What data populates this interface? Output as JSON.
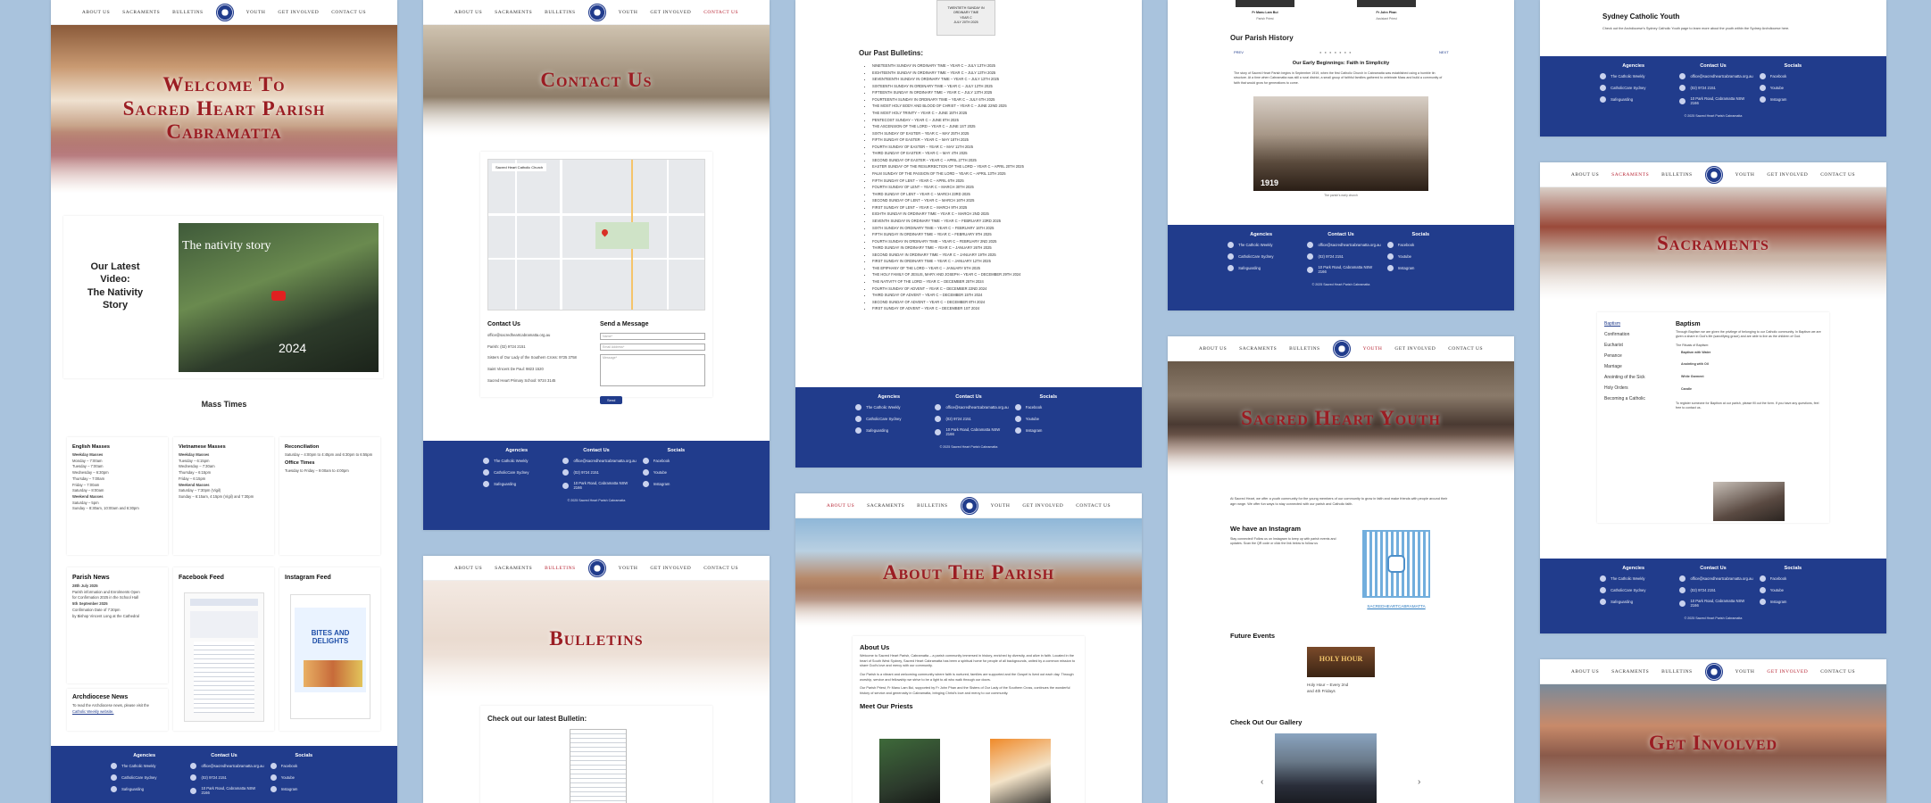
{
  "nav": {
    "left": [
      "About Us",
      "Sacraments",
      "Bulletins"
    ],
    "right": [
      "Youth",
      "Get Involved",
      "Contact Us"
    ]
  },
  "home": {
    "hero_title_lines": [
      "Welcome To",
      "Sacred Heart Parish",
      "Cabramatta"
    ],
    "video_heading_lines": [
      "Our Latest",
      "Video:",
      "The Nativity",
      "Story"
    ],
    "video_title": "The nativity story",
    "video_year": "2024",
    "mass_times_heading": "Mass Times",
    "english_heading": "English Masses",
    "english_lines": [
      "Weekday Masses",
      "Monday – 7:00am",
      "Tuesday – 7:00am",
      "Wednesday – 6:30pm",
      "Thursday – 7:00am",
      "Friday – 7:00am",
      "Saturday – 8:00am",
      "Weekend Masses",
      "Saturday – 5pm",
      "Sunday – 8:30am, 10:00am and 6:30pm"
    ],
    "vietnamese_heading": "Vietnamese Masses",
    "vietnamese_lines": [
      "Weekday Masses",
      "Tuesday – 6:15pm",
      "Wednesday – 7:30am",
      "Thursday – 6:15pm",
      "Friday – 6:15pm",
      "Weekend Masses",
      "Saturday – 7:30pm (Vigil)",
      "Sunday – 6:15am, 4:15pm (Vigil) and 7:30pm"
    ],
    "reconciliation_heading": "Reconciliation",
    "reconciliation_lines": [
      "Saturday – 4:00pm to 4:45pm and 6:30pm to 6:55pm"
    ],
    "office_heading": "Office Times",
    "office_lines": [
      "Tuesday to Friday – 9:00am to 4:00pm"
    ],
    "parish_news_heading": "Parish News",
    "parish_news_lines": [
      "28th July 2025",
      "Parish information and Enrolments Open",
      "for Confirmation 2025 in the School Hall",
      "5th September 2025",
      "Confirmation Date of 7:30pm",
      "by Bishop Vincent Long at the Cathedral"
    ],
    "facebook_heading": "Facebook Feed",
    "instagram_heading": "Instagram Feed",
    "insta_post_title": "BITES AND DELIGHTS",
    "archdiocese_heading": "Archdiocese News",
    "archdiocese_text": "To read the Archdiocese news, please visit the",
    "archdiocese_link": "Catholic Weekly website."
  },
  "footer": {
    "agencies_heading": "Agencies",
    "agencies": [
      "The Catholic Weekly",
      "CatholicCare Sydney",
      "Safeguarding"
    ],
    "contact_heading": "Contact Us",
    "contact": [
      "office@sacredheartcabramatta.org.au",
      "(02) 9724 2151",
      "10 Park Road, Cabramatta NSW 2166"
    ],
    "socials_heading": "Socials",
    "socials": [
      "Facebook",
      "Youtube",
      "Instagram"
    ],
    "copyright": "© 2025 Sacred Heart Parish Cabramatta"
  },
  "contact": {
    "hero_title": "Contact Us",
    "map_label": "Sacred Heart Catholic Church",
    "contact_heading": "Contact Us",
    "contact_lines": [
      "office@sacredheartcabramatta.org.au",
      "Parish: (02) 9724 2151",
      "Sisters of Our Lady of the Southern Cross: 9725 3758",
      "Saint Vincent De Paul: 9823 1520",
      "Sacred Heart Primary School: 9724 3145"
    ],
    "form_heading": "Send a Message",
    "form_name": "Name*",
    "form_email": "Email Address*",
    "form_message": "Message*",
    "send_label": "Send"
  },
  "bulletins": {
    "hero_title": "Bulletins",
    "latest_heading": "Check out our latest Bulletin:"
  },
  "past": {
    "thumb_caption_lines": [
      "TWENTIETH SUNDAY IN",
      "ORDINARY TIME",
      "YEAR C",
      "JULY 20TH 2025"
    ],
    "heading": "Our Past Bulletins:",
    "items": [
      "NINETEENTH SUNDAY IN ORDINARY TIME – YEAR C – JULY 13TH 2025",
      "EIGHTEENTH SUNDAY IN ORDINARY TIME – YEAR C – JULY 13TH 2025",
      "SEVENTEENTH SUNDAY IN ORDINARY TIME – YEAR C – JULY 13TH 2025",
      "SIXTEENTH SUNDAY IN ORDINARY TIME – YEAR C – JULY 13TH 2025",
      "FIFTEENTH SUNDAY IN ORDINARY TIME – YEAR C – JULY 13TH 2025",
      "FOURTEENTH SUNDAY IN ORDINARY TIME – YEAR C – JULY 6TH 2025",
      "THE MOST HOLY BODY AND BLOOD OF CHRIST – YEAR C – JUNE 22ND 2025",
      "THE MOST HOLY TRINITY – YEAR C – JUNE 15TH 2025",
      "PENTECOST SUNDAY – YEAR C – JUNE 8TH 2025",
      "THE ASCENSION OF THE LORD – YEAR C – JUNE 1ST 2025",
      "SIXTH SUNDAY OF EASTER – YEAR C – MAY 25TH 2025",
      "FIFTH SUNDAY OF EASTER – YEAR C – MAY 18TH 2025",
      "FOURTH SUNDAY OF EASTER – YEAR C – MAY 11TH 2025",
      "THIRD SUNDAY OF EASTER – YEAR C – MAY 4TH 2025",
      "SECOND SUNDAY OF EASTER – YEAR C – APRIL 27TH 2025",
      "EASTER SUNDAY OF THE RESURRECTION OF THE LORD – YEAR C – APRIL 20TH 2025",
      "PALM SUNDAY OF THE PASSION OF THE LORD – YEAR C – APRIL 13TH 2025",
      "FIFTH SUNDAY OF LENT – YEAR C – APRIL 6TH 2025",
      "FOURTH SUNDAY OF LENT – YEAR C – MARCH 30TH 2025",
      "THIRD SUNDAY OF LENT – YEAR C – MARCH 23RD 2025",
      "SECOND SUNDAY OF LENT – YEAR C – MARCH 16TH 2025",
      "FIRST SUNDAY OF LENT – YEAR C – MARCH 9TH 2025",
      "EIGHTH SUNDAY IN ORDINARY TIME – YEAR C – MARCH 2ND 2025",
      "SEVENTH SUNDAY IN ORDINARY TIME – YEAR C – FEBRUARY 23RD 2025",
      "SIXTH SUNDAY IN ORDINARY TIME – YEAR C – FEBRUARY 16TH 2025",
      "FIFTH SUNDAY IN ORDINARY TIME – YEAR C – FEBRUARY 9TH 2025",
      "FOURTH SUNDAY IN ORDINARY TIME – YEAR C – FEBRUARY 2ND 2025",
      "THIRD SUNDAY IN ORDINARY TIME – YEAR C – JANUARY 26TH 2025",
      "SECOND SUNDAY IN ORDINARY TIME – YEAR C – JANUARY 19TH 2025",
      "FIRST SUNDAY IN ORDINARY TIME – YEAR C – JANUARY 12TH 2025",
      "THE EPIPHANY OF THE LORD – YEAR C – JANUARY 5TH 2025",
      "THE HOLY FAMILY OF JESUS, MARY AND JOSEPH – YEAR C – DECEMBER 29TH 2024",
      "THE NATIVITY OF THE LORD – YEAR C – DECEMBER 25TH 2024",
      "FOURTH SUNDAY OF ADVENT – YEAR C – DECEMBER 22ND 2024",
      "THIRD SUNDAY OF ADVENT – YEAR C – DECEMBER 15TH 2024",
      "SECOND SUNDAY OF ADVENT – YEAR C – DECEMBER 8TH 2024",
      "FIRST SUNDAY OF ADVENT – YEAR C – DECEMBER 1ST 2024"
    ]
  },
  "about": {
    "hero_title": "About The Parish",
    "about_heading": "About Us",
    "about_p1": "Welcome to Sacred Heart Parish, Cabramatta – a parish community immersed in history, enriched by diversity, and alive in faith. Located in the heart of South West Sydney, Sacred Heart Cabramatta has been a spiritual home for people of all backgrounds, united by a common mission to share God's love and mercy with our community.",
    "about_p2": "Our Parish is a vibrant and welcoming community where faith is nurtured, families are supported and the Gospel is lived out each day. Through worship, service and fellowship we strive to be a light to all who walk through our doors.",
    "about_p3": "Our Parish Priest, Fr Manu Lam Bui, supported by Fr John Phan and the Sisters of Our Lady of the Southern Cross, continues the wonderful history of service and generosity in Cabramatta, bringing Christ's love and mercy to our community.",
    "priests_heading": "Meet Our Priests"
  },
  "history": {
    "priest1_name": "Fr Manu Lam Bui",
    "priest1_role": "Parish Priest",
    "priest2_name": "Fr John Phan",
    "priest2_role": "Assistant Priest",
    "heading": "Our Parish History",
    "prev_label": "PREV",
    "next_label": "NEXT",
    "subheading": "Our Early Beginnings: Faith in Simplicity",
    "text": "The story of Sacred Heart Parish begins in September 1919, when the first Catholic Church in Cabramatta was established using a humble tin structure. At a time when Cabramatta was still a rural district, a small group of faithful families gathered to celebrate Mass and build a community of faith that would grow for generations to come.",
    "photo_year": "1919",
    "photo_caption": "The parish's early church"
  },
  "youth": {
    "hero_title": "Sacred Heart Youth",
    "intro": "At Sacred Heart, we offer a youth community for the young members of our community to grow in faith and make friends with people around their age range. We offer fun ways to stay connected with our parish and Catholic faith.",
    "insta_heading": "We have an Instagram",
    "insta_text": "Stay connected! Follow us on Instagram to keep up with parish events and updates. Scan the QR code or click the link below to follow us",
    "insta_handle": "SACREDHEARTCABRAMATTA",
    "events_heading": "Future Events",
    "event_image_title": "HOLY HOUR",
    "event_lines": [
      "Holy Hour – Every 2nd",
      "and 4th Fridays"
    ],
    "gallery_heading": "Check Out Our Gallery",
    "gallery_prev": "‹",
    "gallery_next": "›"
  },
  "scy": {
    "heading": "Sydney Catholic Youth",
    "text": "Check out the Archdiocese's Sydney Catholic Youth page to learn more about the youth within the Sydney Archdiocese here."
  },
  "sacraments": {
    "hero_title": "Sacraments",
    "list": [
      "Baptism",
      "Confirmation",
      "Eucharist",
      "Penance",
      "Marriage",
      "Anointing of the Sick",
      "Holy Orders",
      "Becoming a Catholic"
    ],
    "detail_heading": "Baptism",
    "detail_intro": "Through Baptism we are given the privilege of belonging to our Catholic community. In Baptism we are given a share in God's life (sanctifying grace) and are able to live as the children of God.",
    "detail_sub": "The Rituals of Baptism:",
    "detail_items": [
      "Baptism with Water",
      "Anointing with Oil",
      "White Garment",
      "Candle"
    ],
    "detail_footer": "To register someone for Baptism at our parish, please fill out the form. If you have any questions, feel free to contact us."
  },
  "involved": {
    "hero_title": "Get Involved"
  }
}
